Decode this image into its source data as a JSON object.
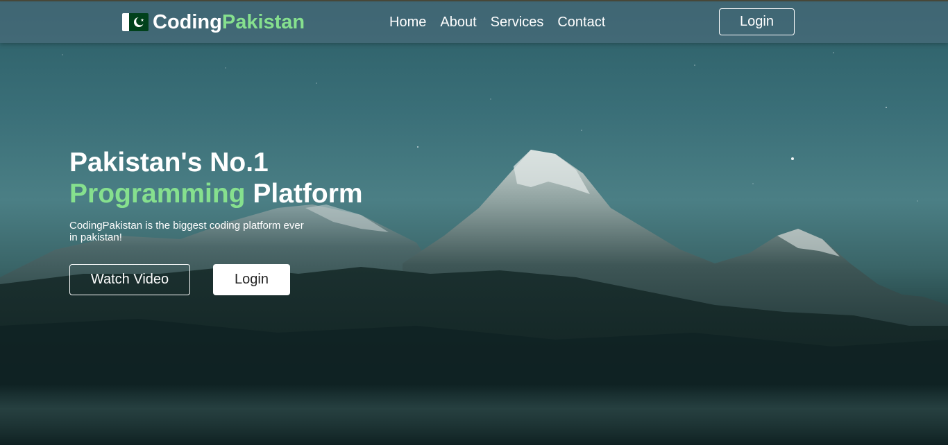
{
  "navbar": {
    "brand_primary": "Coding",
    "brand_accent": "Pakistan",
    "links": [
      {
        "label": "Home"
      },
      {
        "label": "About"
      },
      {
        "label": "Services"
      },
      {
        "label": "Contact"
      }
    ],
    "login_label": "Login"
  },
  "hero": {
    "headline_line1": "Pakistan's No.1",
    "headline_accent": "Programming",
    "headline_rest": "Platform",
    "tagline": "CodingPakistan is the biggest coding platform ever in pakistan!",
    "watch_video_label": "Watch Video",
    "login_label": "Login"
  },
  "colors": {
    "accent_green": "#86e08e",
    "flag_green": "#01411c",
    "text_white": "#ffffff"
  },
  "icons": {
    "flag": "pakistan-flag-icon"
  }
}
